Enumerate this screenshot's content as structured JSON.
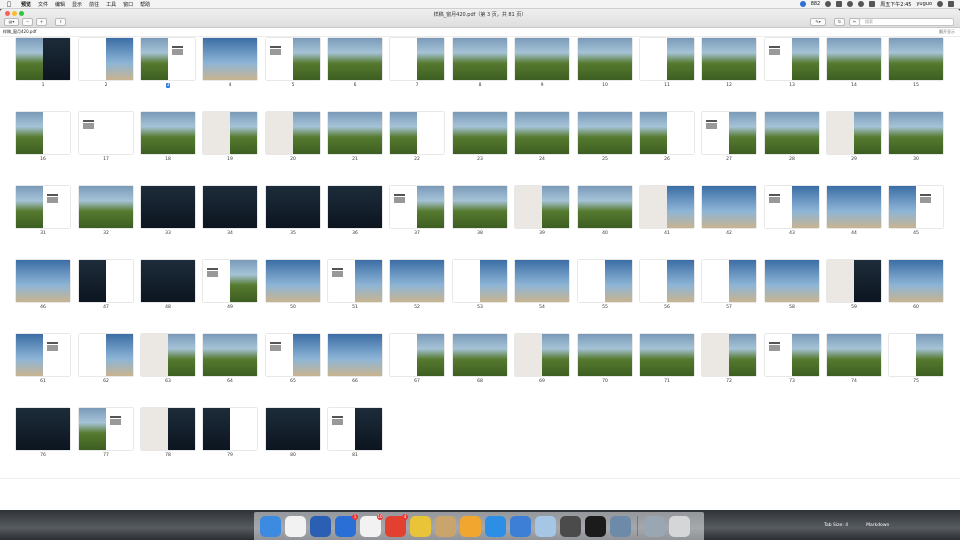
{
  "menubar": {
    "apple": "",
    "items": [
      "预览",
      "文件",
      "编辑",
      "显示",
      "前往",
      "工具",
      "窗口",
      "帮助"
    ],
    "status_badge": "882",
    "clock": "周五下午2:45",
    "user": "yuguo"
  },
  "window": {
    "title": "样稿_窗月420.pdf（第 3 页，共 81 页）",
    "path": "样稿_窗月420.pdf",
    "path_right": "翻开显示",
    "search_placeholder": "搜索"
  },
  "thumbnails": {
    "selected_page": 3,
    "pages": [
      {
        "n": "1",
        "l": "photo",
        "r": "dark"
      },
      {
        "n": "2",
        "l": "white",
        "r": "blue"
      },
      {
        "n": "3",
        "l": "photo",
        "r": "text"
      },
      {
        "n": "4",
        "l": "blue",
        "r": "blue"
      },
      {
        "n": "5",
        "l": "text",
        "r": "photo"
      },
      {
        "n": "6",
        "l": "photo",
        "r": "photo"
      },
      {
        "n": "7",
        "l": "white",
        "r": "photo"
      },
      {
        "n": "8",
        "l": "photo",
        "r": "photo"
      },
      {
        "n": "9",
        "l": "photo",
        "r": "photo"
      },
      {
        "n": "10",
        "l": "photo",
        "r": "photo"
      },
      {
        "n": "11",
        "l": "white",
        "r": "photo"
      },
      {
        "n": "12",
        "l": "photo",
        "r": "photo"
      },
      {
        "n": "13",
        "l": "text",
        "r": "photo"
      },
      {
        "n": "14",
        "l": "photo",
        "r": "photo"
      },
      {
        "n": "15",
        "l": "photo",
        "r": "photo"
      },
      {
        "n": "16",
        "l": "photo",
        "r": "white"
      },
      {
        "n": "17",
        "l": "text",
        "r": "white"
      },
      {
        "n": "18",
        "l": "photo",
        "r": "photo"
      },
      {
        "n": "19",
        "l": "grey",
        "r": "photo"
      },
      {
        "n": "20",
        "l": "grey",
        "r": "photo"
      },
      {
        "n": "21",
        "l": "photo",
        "r": "photo"
      },
      {
        "n": "22",
        "l": "photo",
        "r": "white"
      },
      {
        "n": "23",
        "l": "photo",
        "r": "photo"
      },
      {
        "n": "24",
        "l": "photo",
        "r": "photo"
      },
      {
        "n": "25",
        "l": "photo",
        "r": "photo"
      },
      {
        "n": "26",
        "l": "photo",
        "r": "white"
      },
      {
        "n": "27",
        "l": "text",
        "r": "photo"
      },
      {
        "n": "28",
        "l": "photo",
        "r": "photo"
      },
      {
        "n": "29",
        "l": "grey",
        "r": "photo"
      },
      {
        "n": "30",
        "l": "photo",
        "r": "photo"
      },
      {
        "n": "31",
        "l": "photo",
        "r": "text"
      },
      {
        "n": "32",
        "l": "photo",
        "r": "photo"
      },
      {
        "n": "33",
        "l": "dark",
        "r": "dark"
      },
      {
        "n": "34",
        "l": "dark",
        "r": "dark"
      },
      {
        "n": "35",
        "l": "dark",
        "r": "dark"
      },
      {
        "n": "36",
        "l": "dark",
        "r": "dark"
      },
      {
        "n": "37",
        "l": "text",
        "r": "photo"
      },
      {
        "n": "38",
        "l": "photo",
        "r": "photo"
      },
      {
        "n": "39",
        "l": "grey",
        "r": "photo"
      },
      {
        "n": "40",
        "l": "photo",
        "r": "photo"
      },
      {
        "n": "41",
        "l": "grey",
        "r": "blue"
      },
      {
        "n": "42",
        "l": "blue",
        "r": "blue"
      },
      {
        "n": "43",
        "l": "text",
        "r": "blue"
      },
      {
        "n": "44",
        "l": "blue",
        "r": "blue"
      },
      {
        "n": "45",
        "l": "blue",
        "r": "text"
      },
      {
        "n": "46",
        "l": "blue",
        "r": "blue"
      },
      {
        "n": "47",
        "l": "dark",
        "r": "white"
      },
      {
        "n": "48",
        "l": "dark",
        "r": "dark"
      },
      {
        "n": "49",
        "l": "text",
        "r": "photo"
      },
      {
        "n": "50",
        "l": "blue",
        "r": "blue"
      },
      {
        "n": "51",
        "l": "text",
        "r": "blue"
      },
      {
        "n": "52",
        "l": "blue",
        "r": "blue"
      },
      {
        "n": "53",
        "l": "white",
        "r": "blue"
      },
      {
        "n": "54",
        "l": "blue",
        "r": "blue"
      },
      {
        "n": "55",
        "l": "white",
        "r": "blue"
      },
      {
        "n": "56",
        "l": "white",
        "r": "blue"
      },
      {
        "n": "57",
        "l": "white",
        "r": "blue"
      },
      {
        "n": "58",
        "l": "blue",
        "r": "blue"
      },
      {
        "n": "59",
        "l": "grey",
        "r": "dark"
      },
      {
        "n": "60",
        "l": "blue",
        "r": "blue"
      },
      {
        "n": "61",
        "l": "blue",
        "r": "text"
      },
      {
        "n": "62",
        "l": "white",
        "r": "blue"
      },
      {
        "n": "63",
        "l": "grey",
        "r": "photo"
      },
      {
        "n": "64",
        "l": "photo",
        "r": "photo"
      },
      {
        "n": "65",
        "l": "text",
        "r": "blue"
      },
      {
        "n": "66",
        "l": "blue",
        "r": "blue"
      },
      {
        "n": "67",
        "l": "white",
        "r": "photo"
      },
      {
        "n": "68",
        "l": "photo",
        "r": "photo"
      },
      {
        "n": "69",
        "l": "grey",
        "r": "photo"
      },
      {
        "n": "70",
        "l": "photo",
        "r": "photo"
      },
      {
        "n": "71",
        "l": "photo",
        "r": "photo"
      },
      {
        "n": "72",
        "l": "grey",
        "r": "photo"
      },
      {
        "n": "73",
        "l": "text",
        "r": "photo"
      },
      {
        "n": "74",
        "l": "photo",
        "r": "photo"
      },
      {
        "n": "75",
        "l": "white",
        "r": "photo"
      },
      {
        "n": "76",
        "l": "dark",
        "r": "dark"
      },
      {
        "n": "77",
        "l": "photo",
        "r": "text"
      },
      {
        "n": "78",
        "l": "grey",
        "r": "dark"
      },
      {
        "n": "79",
        "l": "dark",
        "r": "white"
      },
      {
        "n": "80",
        "l": "dark",
        "r": "dark"
      },
      {
        "n": "81",
        "l": "text",
        "r": "dark"
      }
    ]
  },
  "dock": {
    "items": [
      {
        "name": "finder-icon",
        "color": "#3c8be0",
        "badge": ""
      },
      {
        "name": "calendar-icon",
        "color": "#f2f2f2",
        "badge": ""
      },
      {
        "name": "word-icon",
        "color": "#2b5fb4",
        "badge": ""
      },
      {
        "name": "browser-icon",
        "color": "#2a6fd6",
        "badge": "1"
      },
      {
        "name": "qq-icon",
        "color": "#f2f2f2",
        "badge": "10"
      },
      {
        "name": "weibo-icon",
        "color": "#e2412f",
        "badge": "4"
      },
      {
        "name": "chrome-icon",
        "color": "#e9c338",
        "badge": ""
      },
      {
        "name": "archive-icon",
        "color": "#c9a56d",
        "badge": ""
      },
      {
        "name": "sketch-icon",
        "color": "#f1a630",
        "badge": ""
      },
      {
        "name": "safari-icon",
        "color": "#2d8ee6",
        "badge": ""
      },
      {
        "name": "keynote-icon",
        "color": "#3d7ed6",
        "badge": ""
      },
      {
        "name": "preview-icon",
        "color": "#a5c6e5",
        "badge": ""
      },
      {
        "name": "sublime-icon",
        "color": "#4b4b4b",
        "badge": ""
      },
      {
        "name": "terminal-icon",
        "color": "#1b1b1b",
        "badge": ""
      },
      {
        "name": "photo-viewer-icon",
        "color": "#6d8aa8",
        "badge": ""
      },
      {
        "name": "downloads-icon",
        "color": "#9aa6b2",
        "badge": ""
      },
      {
        "name": "trash-icon",
        "color": "#d4d6d8",
        "badge": ""
      }
    ]
  },
  "status_right": {
    "tab_size": "Tab Size: 4",
    "lang": "Markdown"
  }
}
